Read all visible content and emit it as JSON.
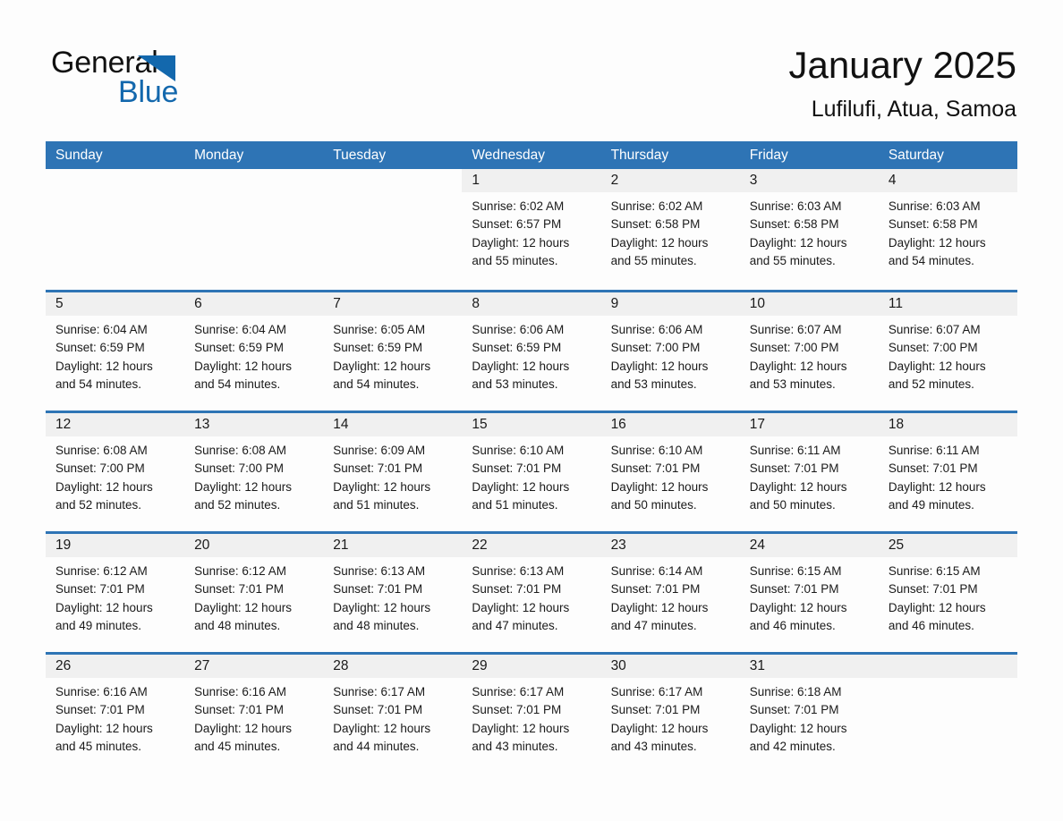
{
  "brand": {
    "name_part1": "General",
    "name_part2": "Blue",
    "accent_color": "#1368ad",
    "triangle_icon": "blue-triangle-icon"
  },
  "header": {
    "title": "January 2025",
    "subtitle": "Lufilufi, Atua, Samoa"
  },
  "calendar": {
    "header_color": "#2e74b5",
    "row_divider_color": "#2e74b5",
    "day_band_color": "#f0f0f0",
    "weekdays": [
      "Sunday",
      "Monday",
      "Tuesday",
      "Wednesday",
      "Thursday",
      "Friday",
      "Saturday"
    ],
    "weeks": [
      [
        {
          "blank": true
        },
        {
          "blank": true
        },
        {
          "blank": true
        },
        {
          "day": "1",
          "sunrise": "Sunrise: 6:02 AM",
          "sunset": "Sunset: 6:57 PM",
          "daylight": "Daylight: 12 hours and 55 minutes."
        },
        {
          "day": "2",
          "sunrise": "Sunrise: 6:02 AM",
          "sunset": "Sunset: 6:58 PM",
          "daylight": "Daylight: 12 hours and 55 minutes."
        },
        {
          "day": "3",
          "sunrise": "Sunrise: 6:03 AM",
          "sunset": "Sunset: 6:58 PM",
          "daylight": "Daylight: 12 hours and 55 minutes."
        },
        {
          "day": "4",
          "sunrise": "Sunrise: 6:03 AM",
          "sunset": "Sunset: 6:58 PM",
          "daylight": "Daylight: 12 hours and 54 minutes."
        }
      ],
      [
        {
          "day": "5",
          "sunrise": "Sunrise: 6:04 AM",
          "sunset": "Sunset: 6:59 PM",
          "daylight": "Daylight: 12 hours and 54 minutes."
        },
        {
          "day": "6",
          "sunrise": "Sunrise: 6:04 AM",
          "sunset": "Sunset: 6:59 PM",
          "daylight": "Daylight: 12 hours and 54 minutes."
        },
        {
          "day": "7",
          "sunrise": "Sunrise: 6:05 AM",
          "sunset": "Sunset: 6:59 PM",
          "daylight": "Daylight: 12 hours and 54 minutes."
        },
        {
          "day": "8",
          "sunrise": "Sunrise: 6:06 AM",
          "sunset": "Sunset: 6:59 PM",
          "daylight": "Daylight: 12 hours and 53 minutes."
        },
        {
          "day": "9",
          "sunrise": "Sunrise: 6:06 AM",
          "sunset": "Sunset: 7:00 PM",
          "daylight": "Daylight: 12 hours and 53 minutes."
        },
        {
          "day": "10",
          "sunrise": "Sunrise: 6:07 AM",
          "sunset": "Sunset: 7:00 PM",
          "daylight": "Daylight: 12 hours and 53 minutes."
        },
        {
          "day": "11",
          "sunrise": "Sunrise: 6:07 AM",
          "sunset": "Sunset: 7:00 PM",
          "daylight": "Daylight: 12 hours and 52 minutes."
        }
      ],
      [
        {
          "day": "12",
          "sunrise": "Sunrise: 6:08 AM",
          "sunset": "Sunset: 7:00 PM",
          "daylight": "Daylight: 12 hours and 52 minutes."
        },
        {
          "day": "13",
          "sunrise": "Sunrise: 6:08 AM",
          "sunset": "Sunset: 7:00 PM",
          "daylight": "Daylight: 12 hours and 52 minutes."
        },
        {
          "day": "14",
          "sunrise": "Sunrise: 6:09 AM",
          "sunset": "Sunset: 7:01 PM",
          "daylight": "Daylight: 12 hours and 51 minutes."
        },
        {
          "day": "15",
          "sunrise": "Sunrise: 6:10 AM",
          "sunset": "Sunset: 7:01 PM",
          "daylight": "Daylight: 12 hours and 51 minutes."
        },
        {
          "day": "16",
          "sunrise": "Sunrise: 6:10 AM",
          "sunset": "Sunset: 7:01 PM",
          "daylight": "Daylight: 12 hours and 50 minutes."
        },
        {
          "day": "17",
          "sunrise": "Sunrise: 6:11 AM",
          "sunset": "Sunset: 7:01 PM",
          "daylight": "Daylight: 12 hours and 50 minutes."
        },
        {
          "day": "18",
          "sunrise": "Sunrise: 6:11 AM",
          "sunset": "Sunset: 7:01 PM",
          "daylight": "Daylight: 12 hours and 49 minutes."
        }
      ],
      [
        {
          "day": "19",
          "sunrise": "Sunrise: 6:12 AM",
          "sunset": "Sunset: 7:01 PM",
          "daylight": "Daylight: 12 hours and 49 minutes."
        },
        {
          "day": "20",
          "sunrise": "Sunrise: 6:12 AM",
          "sunset": "Sunset: 7:01 PM",
          "daylight": "Daylight: 12 hours and 48 minutes."
        },
        {
          "day": "21",
          "sunrise": "Sunrise: 6:13 AM",
          "sunset": "Sunset: 7:01 PM",
          "daylight": "Daylight: 12 hours and 48 minutes."
        },
        {
          "day": "22",
          "sunrise": "Sunrise: 6:13 AM",
          "sunset": "Sunset: 7:01 PM",
          "daylight": "Daylight: 12 hours and 47 minutes."
        },
        {
          "day": "23",
          "sunrise": "Sunrise: 6:14 AM",
          "sunset": "Sunset: 7:01 PM",
          "daylight": "Daylight: 12 hours and 47 minutes."
        },
        {
          "day": "24",
          "sunrise": "Sunrise: 6:15 AM",
          "sunset": "Sunset: 7:01 PM",
          "daylight": "Daylight: 12 hours and 46 minutes."
        },
        {
          "day": "25",
          "sunrise": "Sunrise: 6:15 AM",
          "sunset": "Sunset: 7:01 PM",
          "daylight": "Daylight: 12 hours and 46 minutes."
        }
      ],
      [
        {
          "day": "26",
          "sunrise": "Sunrise: 6:16 AM",
          "sunset": "Sunset: 7:01 PM",
          "daylight": "Daylight: 12 hours and 45 minutes."
        },
        {
          "day": "27",
          "sunrise": "Sunrise: 6:16 AM",
          "sunset": "Sunset: 7:01 PM",
          "daylight": "Daylight: 12 hours and 45 minutes."
        },
        {
          "day": "28",
          "sunrise": "Sunrise: 6:17 AM",
          "sunset": "Sunset: 7:01 PM",
          "daylight": "Daylight: 12 hours and 44 minutes."
        },
        {
          "day": "29",
          "sunrise": "Sunrise: 6:17 AM",
          "sunset": "Sunset: 7:01 PM",
          "daylight": "Daylight: 12 hours and 43 minutes."
        },
        {
          "day": "30",
          "sunrise": "Sunrise: 6:17 AM",
          "sunset": "Sunset: 7:01 PM",
          "daylight": "Daylight: 12 hours and 43 minutes."
        },
        {
          "day": "31",
          "sunrise": "Sunrise: 6:18 AM",
          "sunset": "Sunset: 7:01 PM",
          "daylight": "Daylight: 12 hours and 42 minutes."
        },
        {
          "empty": true
        }
      ]
    ]
  }
}
